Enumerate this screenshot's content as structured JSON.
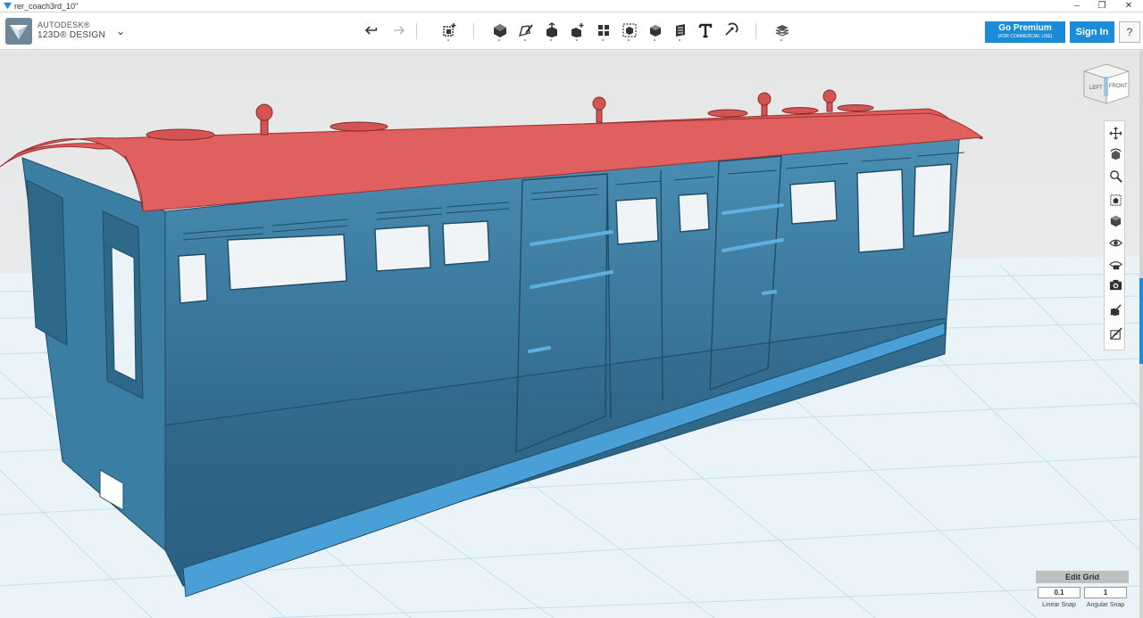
{
  "window": {
    "title": "rer_coach3rd_10\"",
    "minimize": "–",
    "maximize": "❐",
    "close": "✕"
  },
  "brand": {
    "company": "AUTODESK®",
    "product": "123D® DESIGN",
    "caret": "⌄"
  },
  "toolbar": {
    "tools": [
      "undo-icon",
      "redo-icon",
      "transform-icon",
      "primitives-icon",
      "sketch-icon",
      "construct-icon",
      "modify-icon",
      "pattern-icon",
      "grouping-icon",
      "combine-icon",
      "measure-icon",
      "text-icon",
      "snap-icon",
      "material-icon"
    ]
  },
  "account": {
    "premium_label": "Go Premium",
    "premium_sub": "(FOR COMMERCIAL USE)",
    "signin_label": "Sign In",
    "help_label": "?"
  },
  "viewcube": {
    "left_label": "LEFT",
    "front_label": "FRONT"
  },
  "nav": {
    "items": [
      "pan-icon",
      "orbit-icon",
      "zoom-icon",
      "fit-icon",
      "view-icon",
      "visibility-icon",
      "materials-outlines-icon",
      "camera-icon",
      "show-hide-icon",
      "snap-grid-icon"
    ]
  },
  "grid": {
    "edit_label": "Edit Grid",
    "linear_value": "0.1",
    "angular_value": "1",
    "linear_label": "Linear Snap",
    "angular_label": "Angular Snap"
  },
  "colors": {
    "accent": "#1a8cd8",
    "body": "#3a7da3",
    "roof": "#e06060",
    "grid_line": "#bfe0ee",
    "background": "#e9ecef"
  }
}
